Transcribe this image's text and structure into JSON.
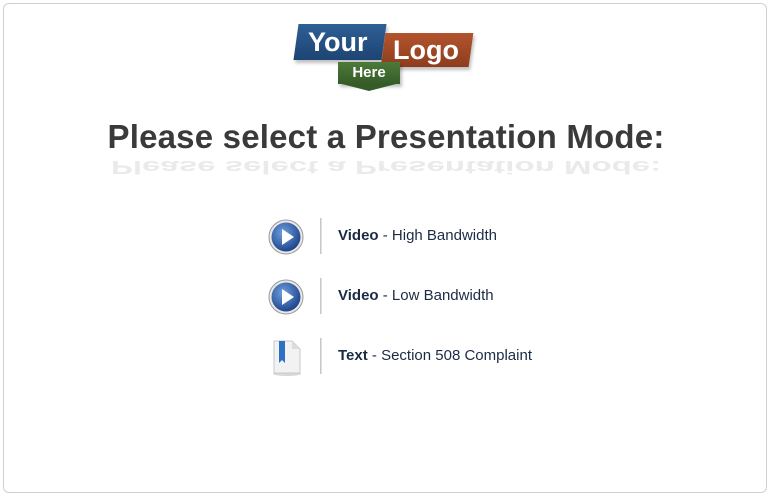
{
  "logo": {
    "line1": "Your",
    "line2": "Logo",
    "line3": "Here"
  },
  "heading": "Please select a Presentation Mode:",
  "options": [
    {
      "icon": "play-icon",
      "title": "Video",
      "rest": " - High Bandwidth"
    },
    {
      "icon": "play-icon",
      "title": "Video",
      "rest": " - Low Bandwidth"
    },
    {
      "icon": "document-icon",
      "title": "Text",
      "rest": " - Section 508 Complaint"
    }
  ],
  "colors": {
    "logo_blue": "#2f5f95",
    "logo_orange": "#b3542e",
    "logo_green": "#4d7a3a",
    "text_navy": "#1c2b45"
  }
}
